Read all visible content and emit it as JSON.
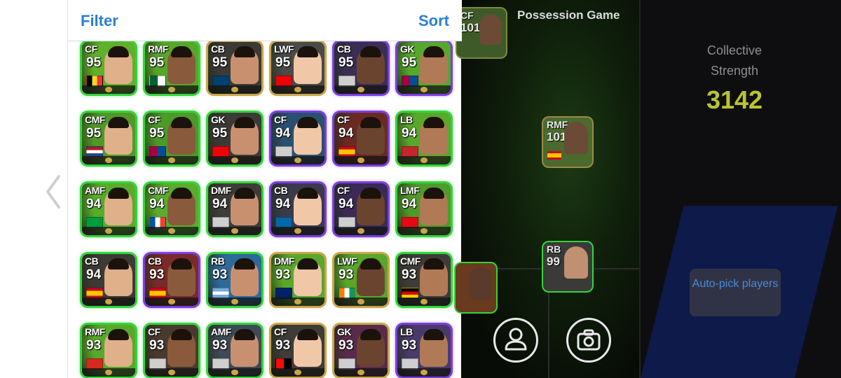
{
  "panel": {
    "filter_label": "Filter",
    "sort_label": "Sort"
  },
  "players": [
    {
      "pos": "CF",
      "ovr": "95",
      "frame": "green",
      "flag": "belgium",
      "bg": "#5fb02a"
    },
    {
      "pos": "RMF",
      "ovr": "95",
      "frame": "green",
      "flag": "algeria",
      "bg": "#58a628"
    },
    {
      "pos": "CB",
      "ovr": "95",
      "frame": "gold",
      "flag": "psg",
      "bg": "#3d3a35"
    },
    {
      "pos": "LWF",
      "ovr": "95",
      "frame": "gold",
      "flag": "arsenal",
      "bg": "#4a4a48"
    },
    {
      "pos": "CB",
      "ovr": "95",
      "frame": "purple",
      "flag": "club",
      "bg": "#3a2e55"
    },
    {
      "pos": "GK",
      "ovr": "95",
      "frame": "purple",
      "flag": "barcelona",
      "bg": "#56a82a"
    },
    {
      "pos": "CMF",
      "ovr": "95",
      "frame": "green",
      "flag": "netherlands",
      "bg": "#4f9a26"
    },
    {
      "pos": "CF",
      "ovr": "95",
      "frame": "green",
      "flag": "barcelona",
      "bg": "#4c9a28"
    },
    {
      "pos": "GK",
      "ovr": "95",
      "frame": "green",
      "flag": "arsenal",
      "bg": "#3c3a36"
    },
    {
      "pos": "CF",
      "ovr": "94",
      "frame": "purple",
      "flag": "club",
      "bg": "#2b4f6e"
    },
    {
      "pos": "CF",
      "ovr": "94",
      "frame": "purple",
      "flag": "spain",
      "bg": "#6a2a22"
    },
    {
      "pos": "LB",
      "ovr": "94",
      "frame": "green",
      "flag": "morocco",
      "bg": "#58a82a"
    },
    {
      "pos": "AMF",
      "ovr": "94",
      "frame": "green",
      "flag": "brazil",
      "bg": "#58ac2a"
    },
    {
      "pos": "CMF",
      "ovr": "94",
      "frame": "green",
      "flag": "france",
      "bg": "#5aac2c"
    },
    {
      "pos": "DMF",
      "ovr": "94",
      "frame": "green",
      "flag": "club",
      "bg": "#3e3c38"
    },
    {
      "pos": "CB",
      "ovr": "94",
      "frame": "purple",
      "flag": "inter",
      "bg": "#3a3a4a"
    },
    {
      "pos": "CF",
      "ovr": "94",
      "frame": "purple",
      "flag": "club",
      "bg": "#3a2a55"
    },
    {
      "pos": "LMF",
      "ovr": "94",
      "frame": "green",
      "flag": "turkey",
      "bg": "#4f9a2a"
    },
    {
      "pos": "CB",
      "ovr": "94",
      "frame": "green",
      "flag": "spain",
      "bg": "#3d3a36"
    },
    {
      "pos": "CB",
      "ovr": "93",
      "frame": "purple",
      "flag": "spain",
      "bg": "#7a2a2a"
    },
    {
      "pos": "RB",
      "ovr": "93",
      "frame": "green",
      "flag": "argentina",
      "bg": "#2c6a9a"
    },
    {
      "pos": "DMF",
      "ovr": "93",
      "frame": "gold",
      "flag": "australia",
      "bg": "#5aa82a"
    },
    {
      "pos": "LWF",
      "ovr": "93",
      "frame": "gold",
      "flag": "ivory",
      "bg": "#58a62a"
    },
    {
      "pos": "CMF",
      "ovr": "93",
      "frame": "green",
      "flag": "germany",
      "bg": "#3e3c38"
    },
    {
      "pos": "RMF",
      "ovr": "93",
      "frame": "green",
      "flag": "switzerland",
      "bg": "#58a82a"
    },
    {
      "pos": "CF",
      "ovr": "93",
      "frame": "green",
      "flag": "club",
      "bg": "#4a3a2e"
    },
    {
      "pos": "AMF",
      "ovr": "93",
      "frame": "green",
      "flag": "club",
      "bg": "#3e4a56"
    },
    {
      "pos": "CF",
      "ovr": "93",
      "frame": "gold",
      "flag": "milan",
      "bg": "#3e3c38"
    },
    {
      "pos": "GK",
      "ovr": "93",
      "frame": "gold",
      "flag": "club",
      "bg": "#5a2a4a"
    },
    {
      "pos": "LB",
      "ovr": "93",
      "frame": "purple",
      "flag": "club",
      "bg": "#4a3a6a"
    }
  ],
  "pitch": {
    "title": "Possession Game",
    "cards": [
      {
        "pos": "CF",
        "ovr": "101"
      },
      {
        "pos": "RMF",
        "ovr": "101"
      },
      {
        "pos": "RB",
        "ovr": "99"
      }
    ]
  },
  "team": {
    "strength_label": "Collective Strength",
    "strength_value": "3142",
    "autopick_label": "Auto-pick players"
  },
  "colors": {
    "accent": "#2a7fd4",
    "strength": "#b8c433",
    "frame_green": "#33d43a",
    "frame_purple": "#7b3de0"
  }
}
